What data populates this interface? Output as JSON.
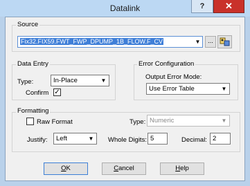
{
  "window": {
    "title": "Datalink"
  },
  "source": {
    "group_label": "Source",
    "value": "Fix32.FIX59.FWT_FWP_DPUMP_1B_FLOW.F_CV",
    "browse_label": "..."
  },
  "data_entry": {
    "group_label": "Data Entry",
    "type_label": "Type:",
    "type_value": "In-Place",
    "confirm_label": "Confirm",
    "confirm_checked": true
  },
  "error_config": {
    "group_label": "Error Configuration",
    "output_mode_label": "Output Error Mode:",
    "output_mode_value": "Use Error Table"
  },
  "formatting": {
    "group_label": "Formatting",
    "raw_format_label": "Raw Format",
    "raw_format_checked": false,
    "type_label": "Type:",
    "type_value": "Numeric",
    "justify_label": "Justify:",
    "justify_value": "Left",
    "whole_digits_label": "Whole Digits:",
    "whole_digits_value": "5",
    "decimal_label": "Decimal:",
    "decimal_value": "2"
  },
  "buttons": {
    "ok": "OK",
    "cancel": "Cancel",
    "help": "Help"
  },
  "titlebar": {
    "help_glyph": "?",
    "close_glyph": "✕"
  }
}
